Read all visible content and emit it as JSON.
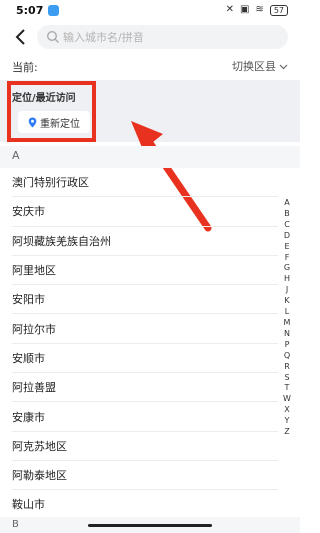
{
  "status_bar": {
    "time": "5:07",
    "battery": "57"
  },
  "search": {
    "placeholder": "输入城市名/拼音",
    "value": ""
  },
  "current": {
    "label": "当前:",
    "switch_label": "切换区县"
  },
  "recent": {
    "title": "定位/最近访问",
    "relocate_label": "重新定位"
  },
  "sections": [
    {
      "letter": "A",
      "cities": [
        "澳门特别行政区",
        "安庆市",
        "阿坝藏族羌族自治州",
        "阿里地区",
        "安阳市",
        "阿拉尔市",
        "安顺市",
        "阿拉善盟",
        "安康市",
        "阿克苏地区",
        "阿勒泰地区",
        "鞍山市"
      ]
    },
    {
      "letter": "B",
      "cities": []
    }
  ],
  "alphabet_index": [
    "A",
    "B",
    "C",
    "D",
    "E",
    "F",
    "G",
    "H",
    "J",
    "K",
    "L",
    "M",
    "N",
    "P",
    "Q",
    "R",
    "S",
    "T",
    "W",
    "X",
    "Y",
    "Z"
  ],
  "colors": {
    "accent": "#e8321f",
    "pin": "#2e7cf6",
    "section_bg": "#eef0f4"
  },
  "icons": {
    "back": "back-arrow-icon",
    "search": "search-icon",
    "pin": "location-pin-icon",
    "chevron": "chevron-down-icon"
  }
}
